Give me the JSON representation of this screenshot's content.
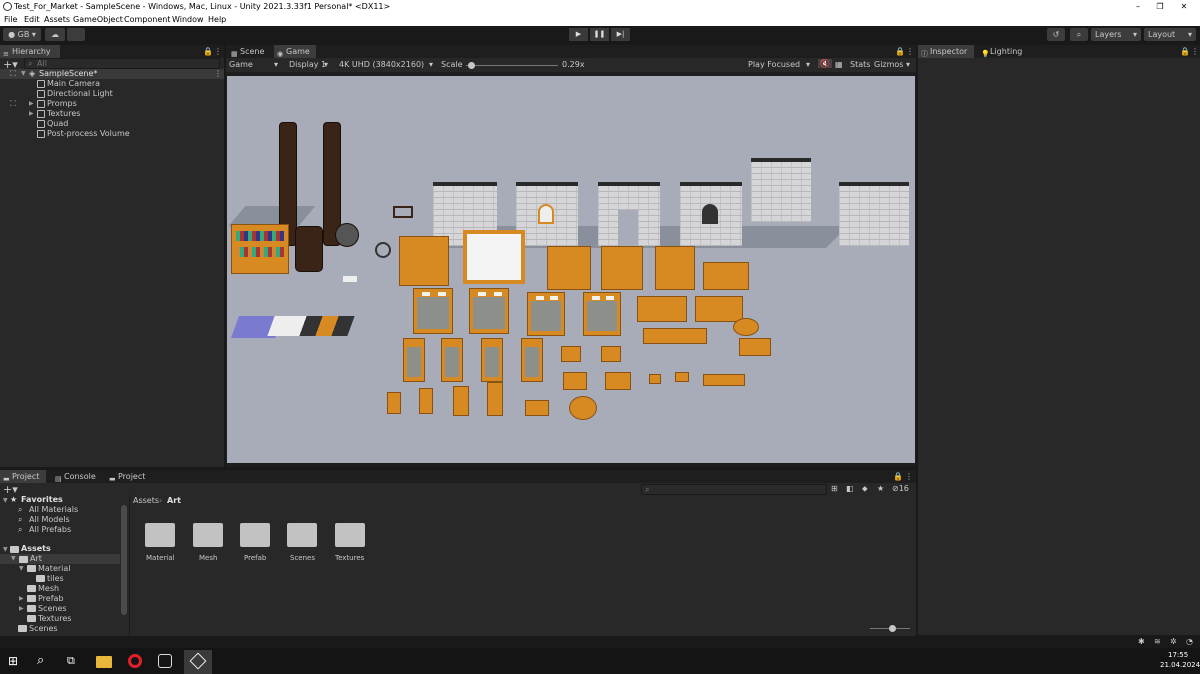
{
  "window": {
    "title": "Test_For_Market - SampleScene - Windows, Mac, Linux - Unity 2021.3.33f1 Personal* <DX11>",
    "controls": [
      "–",
      "❐",
      "✕"
    ]
  },
  "menubar": [
    "File",
    "Edit",
    "Assets",
    "GameObject",
    "Component",
    "Window",
    "Help"
  ],
  "toolbar": {
    "account": "GB",
    "layers": "Layers",
    "layout": "Layout"
  },
  "hierarchy": {
    "tab": "Hierarchy",
    "search_placeholder": "All",
    "scene": "SampleScene*",
    "items": [
      "Main Camera",
      "Directional Light",
      "Promps",
      "Textures",
      "Quad",
      "Post-process Volume"
    ]
  },
  "view_tabs": [
    "Scene",
    "Game"
  ],
  "game_bar": {
    "display_mode": "Game",
    "display": "Display 1",
    "resolution": "4K UHD (3840x2160)",
    "scale_label": "Scale",
    "scale_value": "0.29x",
    "scale_fraction": 0.02,
    "play_mode": "Play Focused",
    "stats": "Stats",
    "gizmos": "Gizmos"
  },
  "inspector_tabs": [
    "Inspector",
    "Lighting"
  ],
  "bottom_tabs": [
    "Project",
    "Console",
    "Project"
  ],
  "project": {
    "favorites_label": "Favorites",
    "favorites": [
      "All Materials",
      "All Models",
      "All Prefabs"
    ],
    "assets_label": "Assets",
    "tree": [
      {
        "label": "Art",
        "level": 1
      },
      {
        "label": "Material",
        "level": 2
      },
      {
        "label": "tiles",
        "level": 3
      },
      {
        "label": "Mesh",
        "level": 2
      },
      {
        "label": "Prefab",
        "level": 2
      },
      {
        "label": "Scenes",
        "level": 2
      },
      {
        "label": "Textures",
        "level": 2
      },
      {
        "label": "Scenes",
        "level": 1
      }
    ],
    "breadcrumb": [
      "Assets",
      "Art"
    ],
    "folders": [
      "Material",
      "Mesh",
      "Prefab",
      "Scenes",
      "Textures"
    ],
    "count_badge": "16"
  },
  "taskbar": {
    "time": "17:55",
    "date": "21.04.2024"
  },
  "colors": {
    "panel_bg": "#282828",
    "tab_bg": "#1e1e1e",
    "game_bg": "#a7acb8",
    "wood": "#d88a22"
  }
}
